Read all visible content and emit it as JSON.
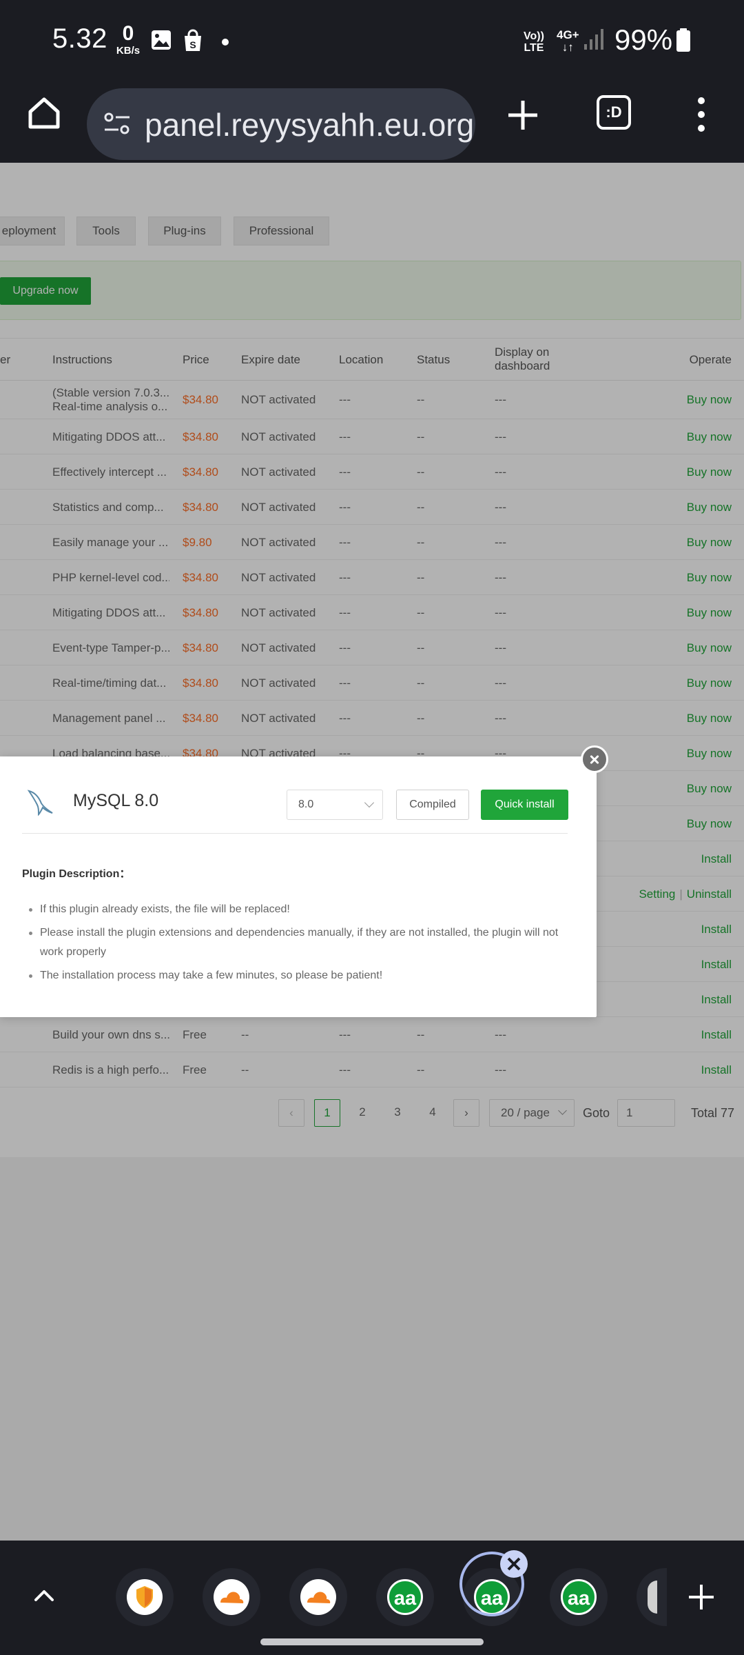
{
  "status_bar": {
    "time": "5.32",
    "net_speed_value": "0",
    "net_speed_unit": "KB/s",
    "volte_top": "Vo))",
    "volte_bottom": "LTE",
    "network_type": "4G+",
    "battery": "99%",
    "icons": [
      "gallery-icon",
      "shopping-bag-icon",
      "notification-dot",
      "data-arrows-icon",
      "signal-icon",
      "battery-icon"
    ]
  },
  "browser": {
    "url": "panel.reyysyahh.eu.org/s",
    "icons": [
      "home-icon",
      "site-settings-icon",
      "new-tab-plus-icon",
      "tab-switch-icon",
      "more-menu-icon"
    ],
    "tab_switch_label": ":D"
  },
  "nav_tabs": [
    "eployment",
    "Tools",
    "Plug-ins",
    "Professional"
  ],
  "upgrade_button": "Upgrade now",
  "table": {
    "headers": {
      "partial": "er",
      "instructions": "Instructions",
      "price": "Price",
      "expire": "Expire date",
      "location": "Location",
      "status": "Status",
      "display_1": "Display on",
      "display_2": "dashboard",
      "operate": "Operate"
    },
    "rows": [
      {
        "instr": "(Stable version 7.0.3...",
        "instr2": "Real-time analysis o...",
        "price": "$34.80",
        "expire": "NOT activated",
        "location": "---",
        "status": "--",
        "display": "---",
        "op": "Buy now"
      },
      {
        "instr": "Mitigating DDOS att...",
        "price": "$34.80",
        "expire": "NOT activated",
        "location": "---",
        "status": "--",
        "display": "---",
        "op": "Buy now"
      },
      {
        "instr": "Effectively intercept ...",
        "price": "$34.80",
        "expire": "NOT activated",
        "location": "---",
        "status": "--",
        "display": "---",
        "op": "Buy now"
      },
      {
        "instr": "Statistics and comp...",
        "price": "$34.80",
        "expire": "NOT activated",
        "location": "---",
        "status": "--",
        "display": "---",
        "op": "Buy now"
      },
      {
        "instr": "Easily manage your ...",
        "price": "$9.80",
        "expire": "NOT activated",
        "location": "---",
        "status": "--",
        "display": "---",
        "op": "Buy now"
      },
      {
        "instr": "PHP kernel-level cod...",
        "price": "$34.80",
        "expire": "NOT activated",
        "location": "---",
        "status": "--",
        "display": "---",
        "op": "Buy now"
      },
      {
        "instr": "Mitigating DDOS att...",
        "price": "$34.80",
        "expire": "NOT activated",
        "location": "---",
        "status": "--",
        "display": "---",
        "op": "Buy now"
      },
      {
        "instr": "Event-type Tamper-p...",
        "price": "$34.80",
        "expire": "NOT activated",
        "location": "---",
        "status": "--",
        "display": "---",
        "op": "Buy now"
      },
      {
        "instr": "Real-time/timing dat...",
        "price": "$34.80",
        "expire": "NOT activated",
        "location": "---",
        "status": "--",
        "display": "---",
        "op": "Buy now"
      },
      {
        "instr": "Management panel ...",
        "price": "$34.80",
        "expire": "NOT activated",
        "location": "---",
        "status": "--",
        "display": "---",
        "op": "Buy now"
      },
      {
        "instr": "Load balancing base...",
        "price": "$34.80",
        "expire": "NOT activated",
        "location": "---",
        "status": "--",
        "display": "---",
        "op": "Buy now"
      },
      {
        "instr": "",
        "price": "",
        "expire": "",
        "location": "",
        "status": "",
        "display": "",
        "op": "Buy now"
      },
      {
        "instr": "",
        "price": "",
        "expire": "",
        "location": "",
        "status": "",
        "display": "",
        "op": "Buy now"
      },
      {
        "instr": "",
        "price": "",
        "expire": "",
        "location": "",
        "status": "",
        "display": "",
        "op": "Install"
      },
      {
        "instr": "",
        "price": "",
        "expire": "",
        "location": "",
        "status": "",
        "display": "",
        "op": "Setting",
        "op2": "Uninstall"
      },
      {
        "instr": "",
        "price": "",
        "expire": "",
        "location": "",
        "status": "",
        "display": "",
        "op": "Install"
      },
      {
        "instr": "",
        "price": "",
        "expire": "",
        "location": "",
        "status": "",
        "display": "",
        "op": "Install"
      },
      {
        "instr": "",
        "price": "",
        "expire": "",
        "location": "",
        "status": "",
        "display": "",
        "op": "Install"
      },
      {
        "instr": "Build your own dns s...",
        "price": "Free",
        "expire": "--",
        "location": "---",
        "status": "--",
        "display": "---",
        "op": "Install"
      },
      {
        "instr": "Redis is a high perfo...",
        "price": "Free",
        "expire": "--",
        "location": "---",
        "status": "--",
        "display": "---",
        "op": "Install"
      }
    ]
  },
  "pagination": {
    "prev": "‹",
    "pages": [
      "1",
      "2",
      "3",
      "4"
    ],
    "current": "1",
    "next": "›",
    "per_page": "20 / page",
    "goto_label": "Goto",
    "goto_value": "1",
    "total": "Total 77"
  },
  "modal": {
    "title": "MySQL 8.0",
    "version_selected": "8.0",
    "compiled_label": "Compiled",
    "quick_install_label": "Quick install",
    "desc_title": "Plugin Description：",
    "desc_items": [
      "If this plugin already exists, the file will be replaced!",
      "Please install the plugin extensions and dependencies manually, if they are not installed, the plugin will not work properly",
      "The installation process may take a few minutes, so please be patient!"
    ]
  },
  "tab_switcher": {
    "tabs": [
      "shield-favicon",
      "cloudflare-favicon",
      "cloudflare-favicon",
      "aa-favicon",
      "aa-favicon",
      "aa-favicon"
    ],
    "aa_label": "aa",
    "icons": [
      "chevron-up-icon",
      "close-tab-icon",
      "new-tab-plus-icon"
    ]
  },
  "colors": {
    "accent_green": "#20a53a",
    "price_orange": "#fc6d26",
    "chrome_dark": "#1b1c22"
  }
}
